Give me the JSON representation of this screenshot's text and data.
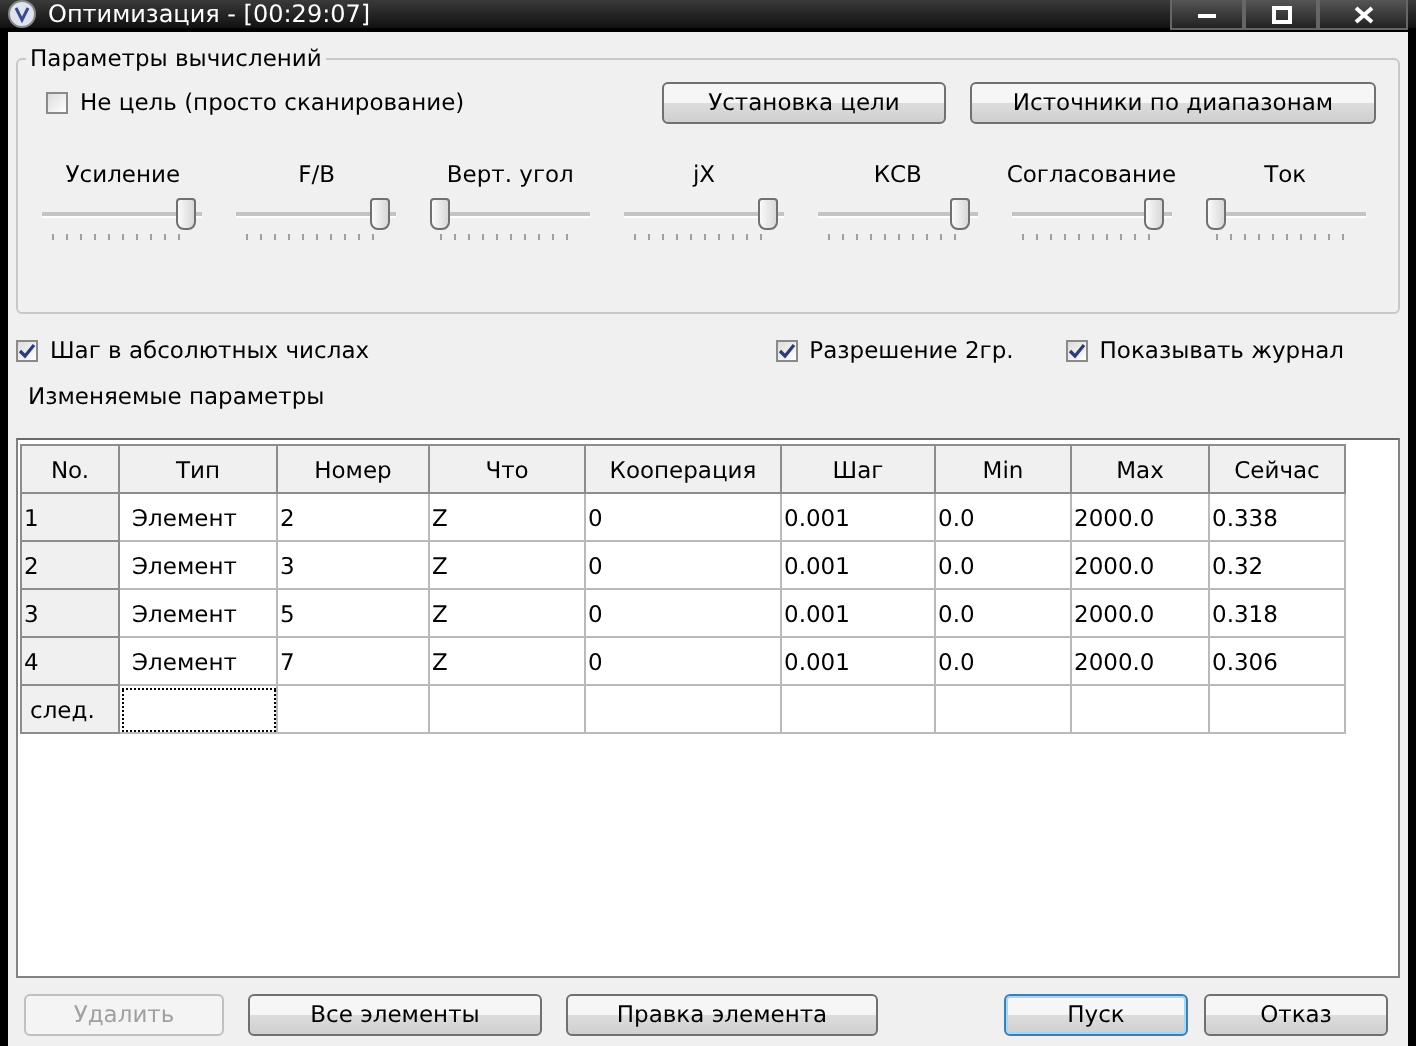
{
  "window": {
    "title": "Оптимизация - [00:29:07]"
  },
  "calc_group": {
    "title": "Параметры вычислений",
    "no_target": {
      "label": "Не цель (просто сканирование)",
      "checked": false
    },
    "buttons": [
      {
        "label": "Установка цели"
      },
      {
        "label": "Источники по диапазонам"
      }
    ],
    "sliders": [
      {
        "label": "Усиление",
        "level": 0.95
      },
      {
        "label": "F/B",
        "level": 0.95
      },
      {
        "label": "Верт. угол",
        "level": 0
      },
      {
        "label": "jX",
        "level": 0.95
      },
      {
        "label": "КСВ",
        "level": 0.95
      },
      {
        "label": "Согласование",
        "level": 0.95
      },
      {
        "label": "Ток",
        "level": 0
      }
    ]
  },
  "options": [
    {
      "label": "Шаг в абсолютных числах",
      "checked": true
    },
    {
      "label": "Разрешение 2гр.",
      "checked": true
    },
    {
      "label": "Показывать журнал",
      "checked": true
    }
  ],
  "params_label": "Изменяемые параметры",
  "table": {
    "columns": [
      "No.",
      "Тип",
      "Номер",
      "Что",
      "Кооперация",
      "Шаг",
      "Min",
      "Max",
      "Сейчас"
    ],
    "rows": [
      [
        "1",
        "Элемент",
        "2",
        "Z",
        "0",
        "0.001",
        "0.0",
        "2000.0",
        "0.338"
      ],
      [
        "2",
        "Элемент",
        "3",
        "Z",
        "0",
        "0.001",
        "0.0",
        "2000.0",
        "0.32"
      ],
      [
        "3",
        "Элемент",
        "5",
        "Z",
        "0",
        "0.001",
        "0.0",
        "2000.0",
        "0.318"
      ],
      [
        "4",
        "Элемент",
        "7",
        "Z",
        "0",
        "0.001",
        "0.0",
        "2000.0",
        "0.306"
      ]
    ],
    "new_row_label": "след."
  },
  "buttons": [
    {
      "label": "Удалить",
      "disabled": true,
      "default": false
    },
    {
      "label": "Все элементы",
      "disabled": false,
      "default": false
    },
    {
      "label": "Правка элемента",
      "disabled": false,
      "default": false
    },
    {
      "label": "Пуск",
      "disabled": false,
      "default": true
    },
    {
      "label": "Отказ",
      "disabled": false,
      "default": false
    }
  ]
}
